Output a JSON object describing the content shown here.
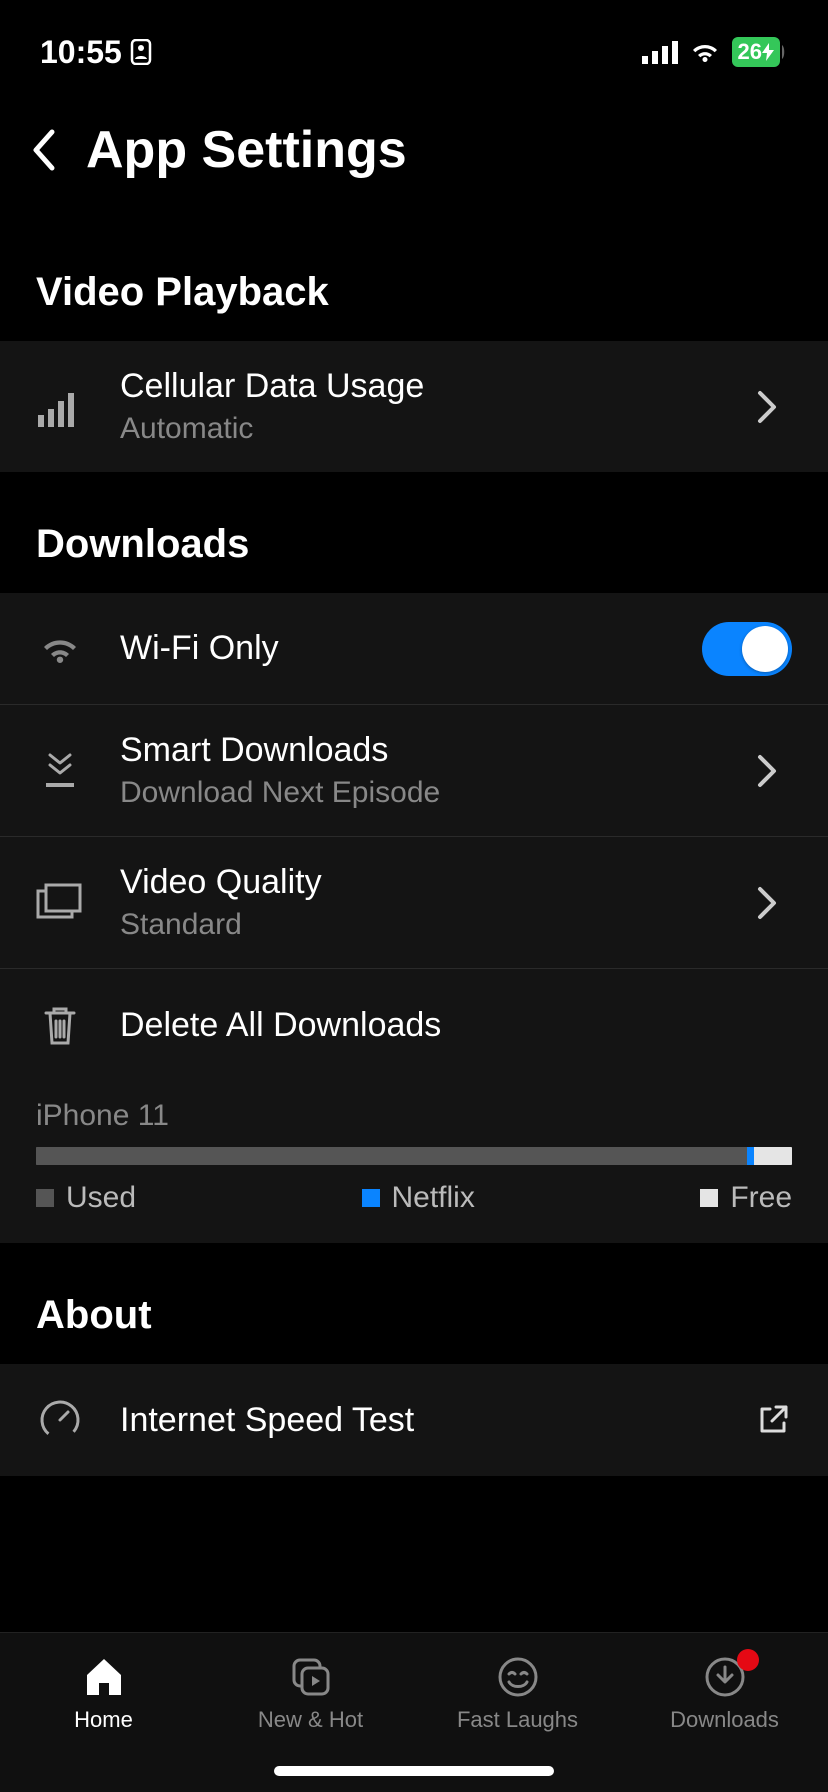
{
  "status": {
    "time": "10:55",
    "battery": "26"
  },
  "header": {
    "title": "App Settings"
  },
  "sections": {
    "video_playback": {
      "title": "Video Playback"
    },
    "downloads": {
      "title": "Downloads"
    },
    "about": {
      "title": "About"
    }
  },
  "rows": {
    "cellular": {
      "title": "Cellular Data Usage",
      "sub": "Automatic"
    },
    "wifi_only": {
      "title": "Wi-Fi Only",
      "toggle": true
    },
    "smart_downloads": {
      "title": "Smart Downloads",
      "sub": "Download Next Episode"
    },
    "video_quality": {
      "title": "Video Quality",
      "sub": "Standard"
    },
    "delete_all": {
      "title": "Delete All Downloads"
    },
    "speed_test": {
      "title": "Internet Speed Test"
    }
  },
  "storage": {
    "device": "iPhone 11",
    "used_pct": 94,
    "netflix_pct": 1,
    "free_pct": 5,
    "legend": {
      "used": "Used",
      "netflix": "Netflix",
      "free": "Free"
    }
  },
  "tabs": {
    "home": "Home",
    "new_hot": "New & Hot",
    "fast_laughs": "Fast Laughs",
    "downloads": "Downloads"
  }
}
